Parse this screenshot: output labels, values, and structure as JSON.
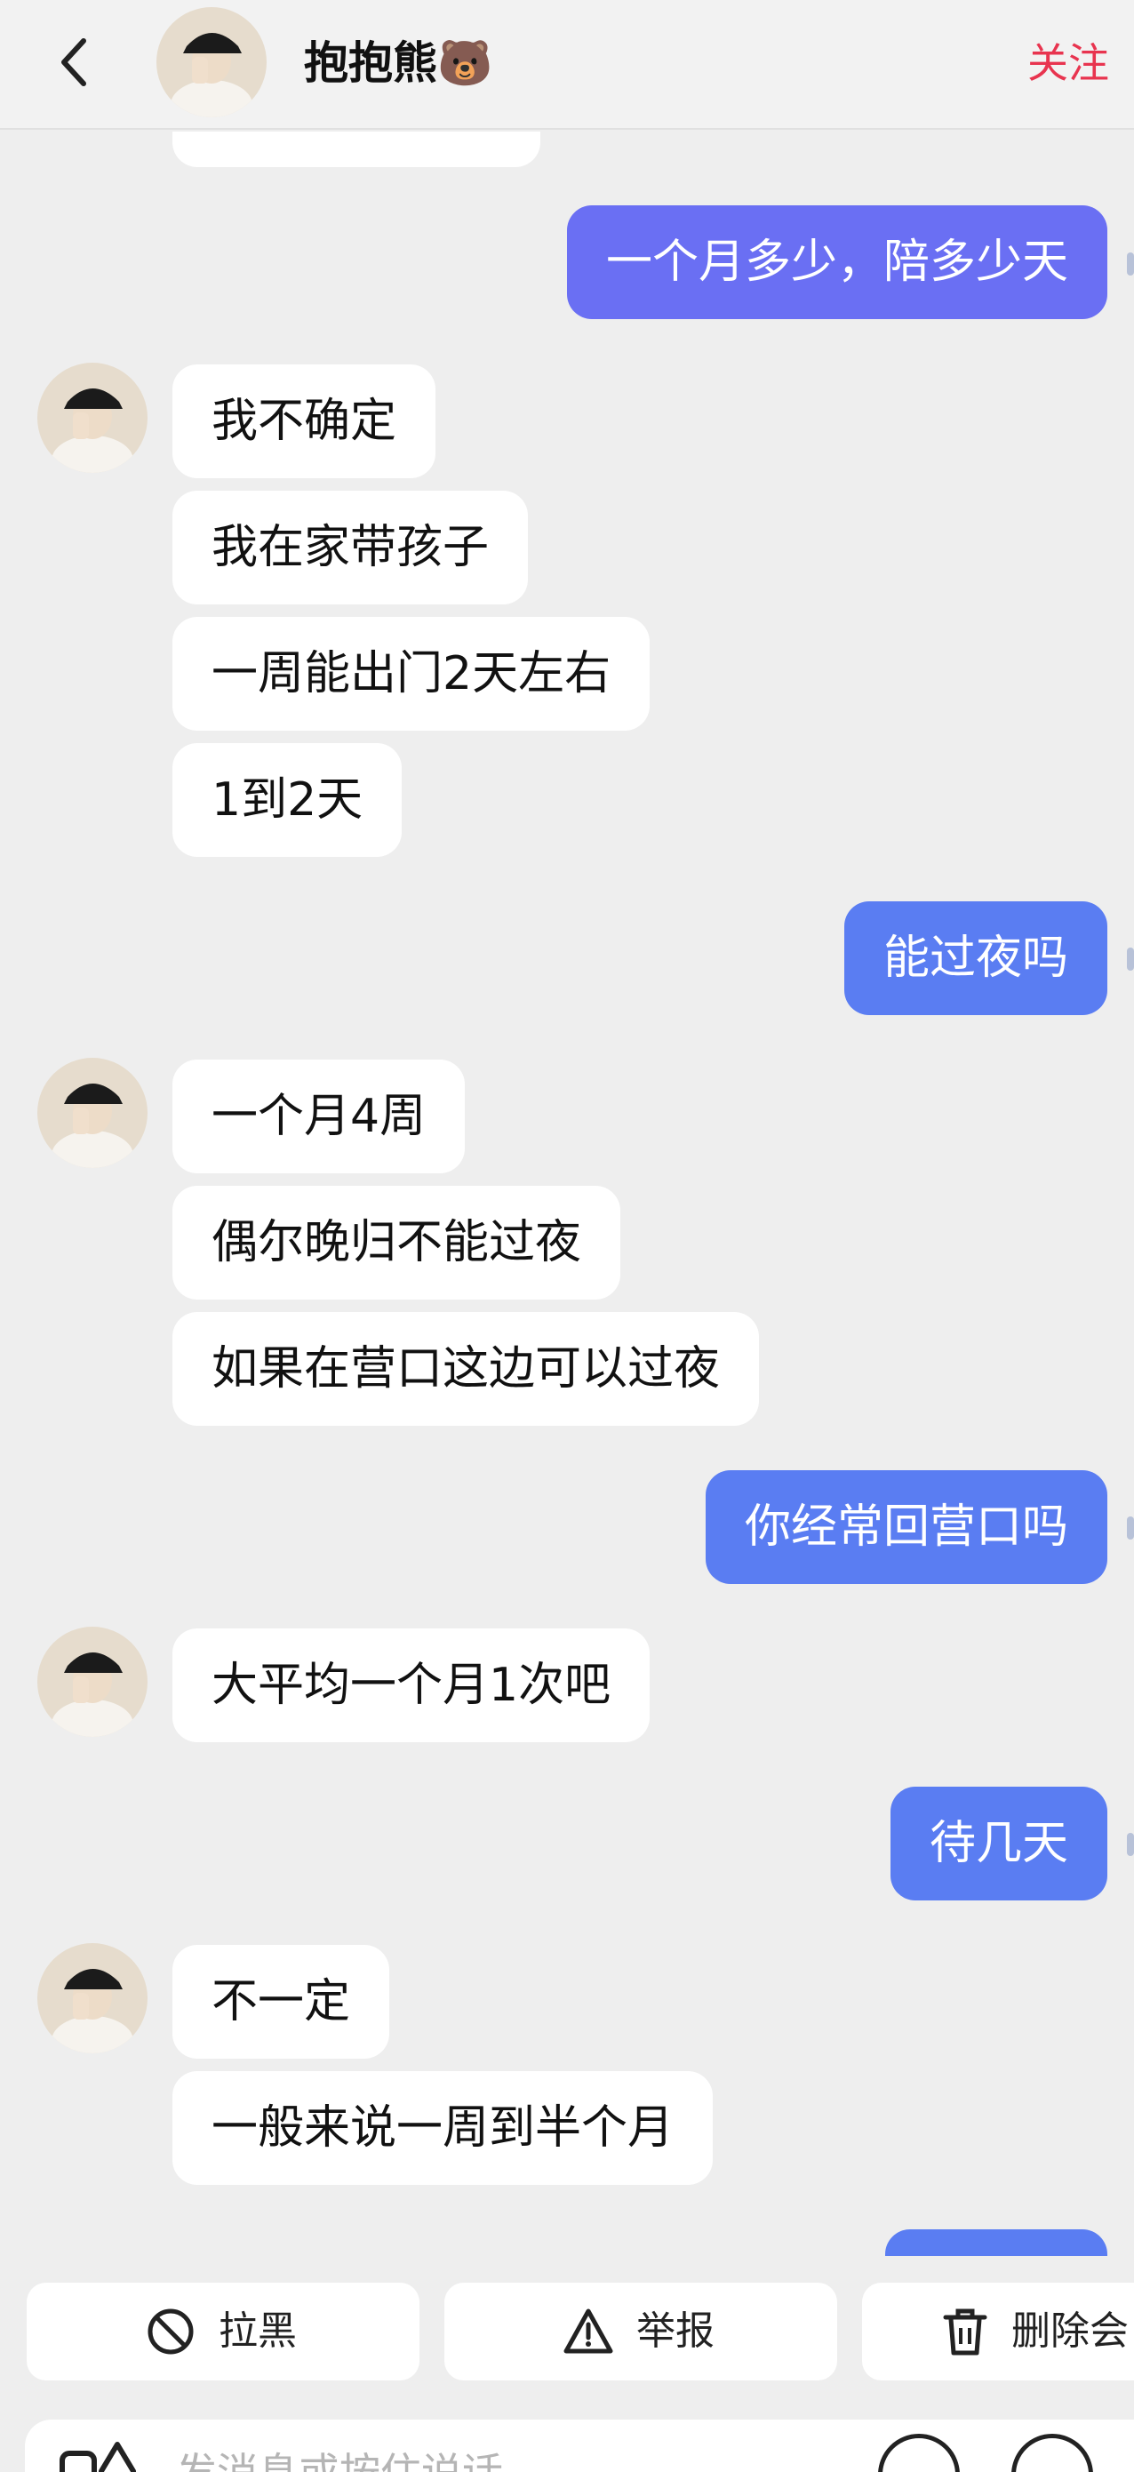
{
  "header": {
    "back_icon": "chevron-left-icon",
    "contact_name": "抱抱熊🐻",
    "follow_label": "关注",
    "follow_color": "#e8344f"
  },
  "colors": {
    "background": "#eeeeee",
    "incoming_bubble": "#ffffff",
    "outgoing_bubble": "#5a7df2",
    "outgoing_bubble_alt": "#6a6ff3"
  },
  "messages": [
    {
      "side": "in",
      "text": ""
    },
    {
      "side": "out",
      "text": "一个月多少，陪多少天"
    },
    {
      "side": "in",
      "text": "我不确定"
    },
    {
      "side": "in",
      "text": "我在家带孩子"
    },
    {
      "side": "in",
      "text": "一周能出门2天左右"
    },
    {
      "side": "in",
      "text": "1到2天"
    },
    {
      "side": "out",
      "text": "能过夜吗"
    },
    {
      "side": "in",
      "text": "一个月4周"
    },
    {
      "side": "in",
      "text": "偶尔晚归不能过夜"
    },
    {
      "side": "in",
      "text": "如果在营口这边可以过夜"
    },
    {
      "side": "out",
      "text": "你经常回营口吗"
    },
    {
      "side": "in",
      "text": "大平均一个月1次吧"
    },
    {
      "side": "out",
      "text": "待几天"
    },
    {
      "side": "in",
      "text": "不一定"
    },
    {
      "side": "in",
      "text": "一般来说一周到半个月"
    },
    {
      "side": "out",
      "text": ""
    }
  ],
  "actions": [
    {
      "label": "拉黑",
      "icon": "block-icon"
    },
    {
      "label": "举报",
      "icon": "warning-icon"
    },
    {
      "label": "删除会",
      "icon": "trash-icon"
    }
  ],
  "composer": {
    "placeholder": "发消息或按住说话",
    "left_icon": "shop-icon",
    "right_icons": [
      "emoji-icon",
      "plus-icon"
    ]
  }
}
